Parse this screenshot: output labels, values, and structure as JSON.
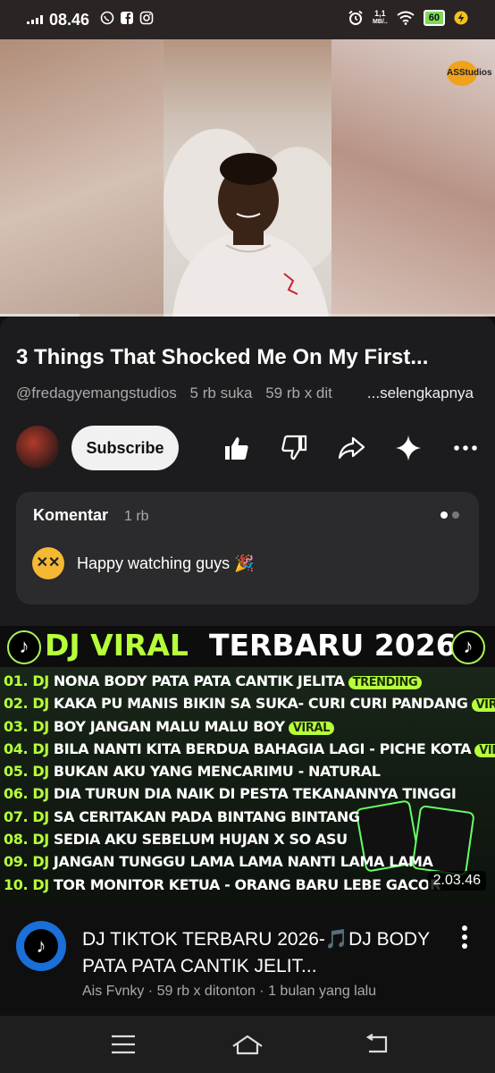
{
  "status_bar": {
    "time": "08.46",
    "icons_left": [
      "whatsapp-icon",
      "facebook-icon",
      "instagram-icon"
    ],
    "icons_right": [
      "alarm-icon",
      "data-speed-icon",
      "wifi-icon",
      "battery-icon",
      "charging-icon"
    ],
    "data_speed": "1,1",
    "data_unit": "MB/..",
    "battery": "60"
  },
  "player": {
    "watermark": "ASStudios",
    "progress": 0.16
  },
  "video": {
    "title": "3 Things That Shocked Me On My First...",
    "channel_handle": "@fredagyemangstudios",
    "likes": "5 rb suka",
    "views": "59 rb x dit",
    "more_label": "...selengkapnya",
    "subscribe_label": "Subscribe"
  },
  "actions": [
    "like-icon",
    "dislike-icon",
    "share-icon",
    "remix-icon",
    "more-icon"
  ],
  "comments": {
    "label": "Komentar",
    "count": "1 rb",
    "top_comment": "Happy watching guys 🎉"
  },
  "thumbnail": {
    "headline_a": "DJ VIRAL",
    "headline_b": "TERBARU 2026",
    "tracks": [
      {
        "num": "01. DJ",
        "name": "NONA BODY PATA PATA CANTIK JELITA",
        "tag": "TRENDING"
      },
      {
        "num": "02. DJ",
        "name": "KAKA PU MANIS BIKIN SA SUKA- CURI CURI PANDANG",
        "tag": "VIRAL"
      },
      {
        "num": "03. DJ",
        "name": "BOY JANGAN MALU MALU BOY",
        "tag": "VIRAL"
      },
      {
        "num": "04. DJ",
        "name": "BILA NANTI KITA BERDUA BAHAGIA LAGI - PICHE KOTA",
        "tag": "VIRAL"
      },
      {
        "num": "05. DJ",
        "name": "BUKAN AKU YANG MENCARIMU - NATURAL",
        "tag": ""
      },
      {
        "num": "06. DJ",
        "name": "DIA TURUN DIA NAIK DI PESTA TEKANANNYA TINGGI",
        "tag": ""
      },
      {
        "num": "07. DJ",
        "name": "SA CERITAKAN PADA BINTANG BINTANG",
        "tag": ""
      },
      {
        "num": "08. DJ",
        "name": "SEDIA AKU SEBELUM HUJAN X SO ASU",
        "tag": ""
      },
      {
        "num": "09. DJ",
        "name": "JANGAN TUNGGU LAMA LAMA NANTI LAMA LAMA",
        "tag": ""
      },
      {
        "num": "10. DJ",
        "name": "TOR MONITOR KETUA - ORANG BARU LEBE GACOR",
        "tag": ""
      }
    ],
    "duration": "2.03.46"
  },
  "next_video": {
    "title": "DJ TIKTOK TERBARU 2026-🎵DJ BODY PATA PATA CANTIK JELIT...",
    "channel": "Ais Fvnky",
    "views": "59 rb x ditonton",
    "age": "1 bulan yang lalu"
  },
  "nav_bar": [
    "menu-icon",
    "home-icon",
    "back-icon"
  ]
}
